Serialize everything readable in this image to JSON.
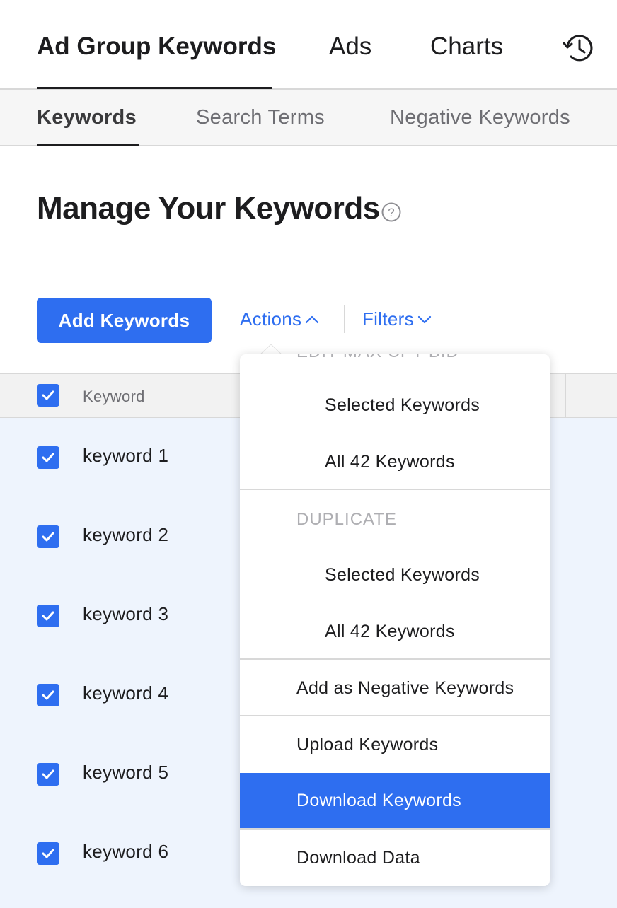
{
  "topnav": {
    "tabs": [
      {
        "label": "Ad Group Keywords"
      },
      {
        "label": "Ads"
      },
      {
        "label": "Charts"
      }
    ],
    "history_icon": "history-icon"
  },
  "subnav": {
    "tabs": [
      {
        "label": "Keywords"
      },
      {
        "label": "Search Terms"
      },
      {
        "label": "Negative Keywords"
      }
    ]
  },
  "page": {
    "title": "Manage Your Keywords",
    "help_icon": "question-circle-icon"
  },
  "toolbar": {
    "add_label": "Add Keywords",
    "actions_label": "Actions",
    "filters_label": "Filters"
  },
  "table": {
    "column_keyword": "Keyword",
    "rows": [
      {
        "keyword": "keyword 1",
        "checked": true
      },
      {
        "keyword": "keyword 2",
        "checked": true
      },
      {
        "keyword": "keyword 3",
        "checked": true
      },
      {
        "keyword": "keyword 4",
        "checked": true
      },
      {
        "keyword": "keyword 5",
        "checked": true
      },
      {
        "keyword": "keyword 6",
        "checked": true
      }
    ]
  },
  "actions_menu": {
    "cut_heading": "EDIT MAX CPT BID",
    "edit_items": [
      "Selected Keywords",
      "All 42 Keywords"
    ],
    "duplicate_heading": "DUPLICATE",
    "duplicate_items": [
      "Selected Keywords",
      "All 42 Keywords"
    ],
    "add_negative": "Add as Negative Keywords",
    "upload": "Upload Keywords",
    "download_keywords": "Download Keywords",
    "download_data": "Download Data",
    "highlighted": "Download Keywords"
  },
  "colors": {
    "accent": "#2e6ef0",
    "row_selected_bg": "#eef4fd"
  }
}
